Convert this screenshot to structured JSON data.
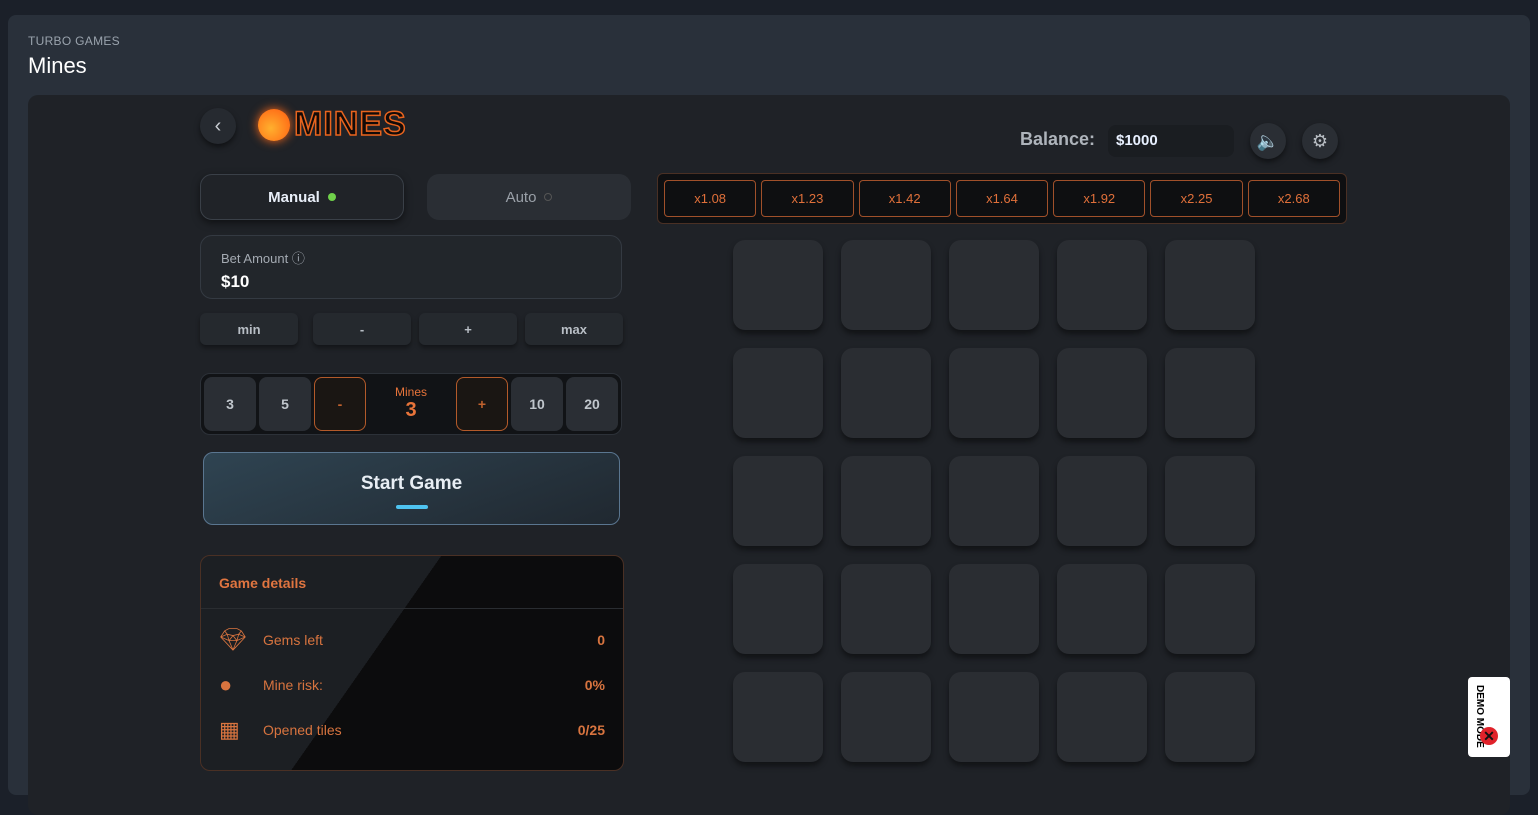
{
  "header": {
    "breadcrumb": "TURBO GAMES",
    "title": "Mines"
  },
  "game": {
    "logo": "MINES",
    "balance_label": "Balance:",
    "balance": "$1000",
    "tabs": {
      "manual": "Manual",
      "auto": "Auto"
    },
    "bet": {
      "label": "Bet Amount",
      "value": "$10"
    },
    "bet_buttons": [
      "min",
      "-",
      "+",
      "max"
    ],
    "mines_selector": {
      "presets_left": [
        "3",
        "5"
      ],
      "minus": "-",
      "label": "Mines",
      "value": "3",
      "plus": "+",
      "presets_right": [
        "10",
        "20"
      ]
    },
    "start_label": "Start Game",
    "details": {
      "title": "Game details",
      "rows": [
        {
          "label": "Gems left",
          "value": "0"
        },
        {
          "label": "Mine risk:",
          "value": "0%"
        },
        {
          "label": "Opened tiles",
          "value": "0/25"
        }
      ]
    },
    "multipliers": [
      "x1.08",
      "x1.23",
      "x1.42",
      "x1.64",
      "x1.92",
      "x2.25",
      "x2.68"
    ],
    "demo_badge": "DEMO MODE",
    "colors": {
      "accent": "#e0703a",
      "active_dot": "#6fd04a",
      "start_bar": "#4ec3f0"
    }
  }
}
